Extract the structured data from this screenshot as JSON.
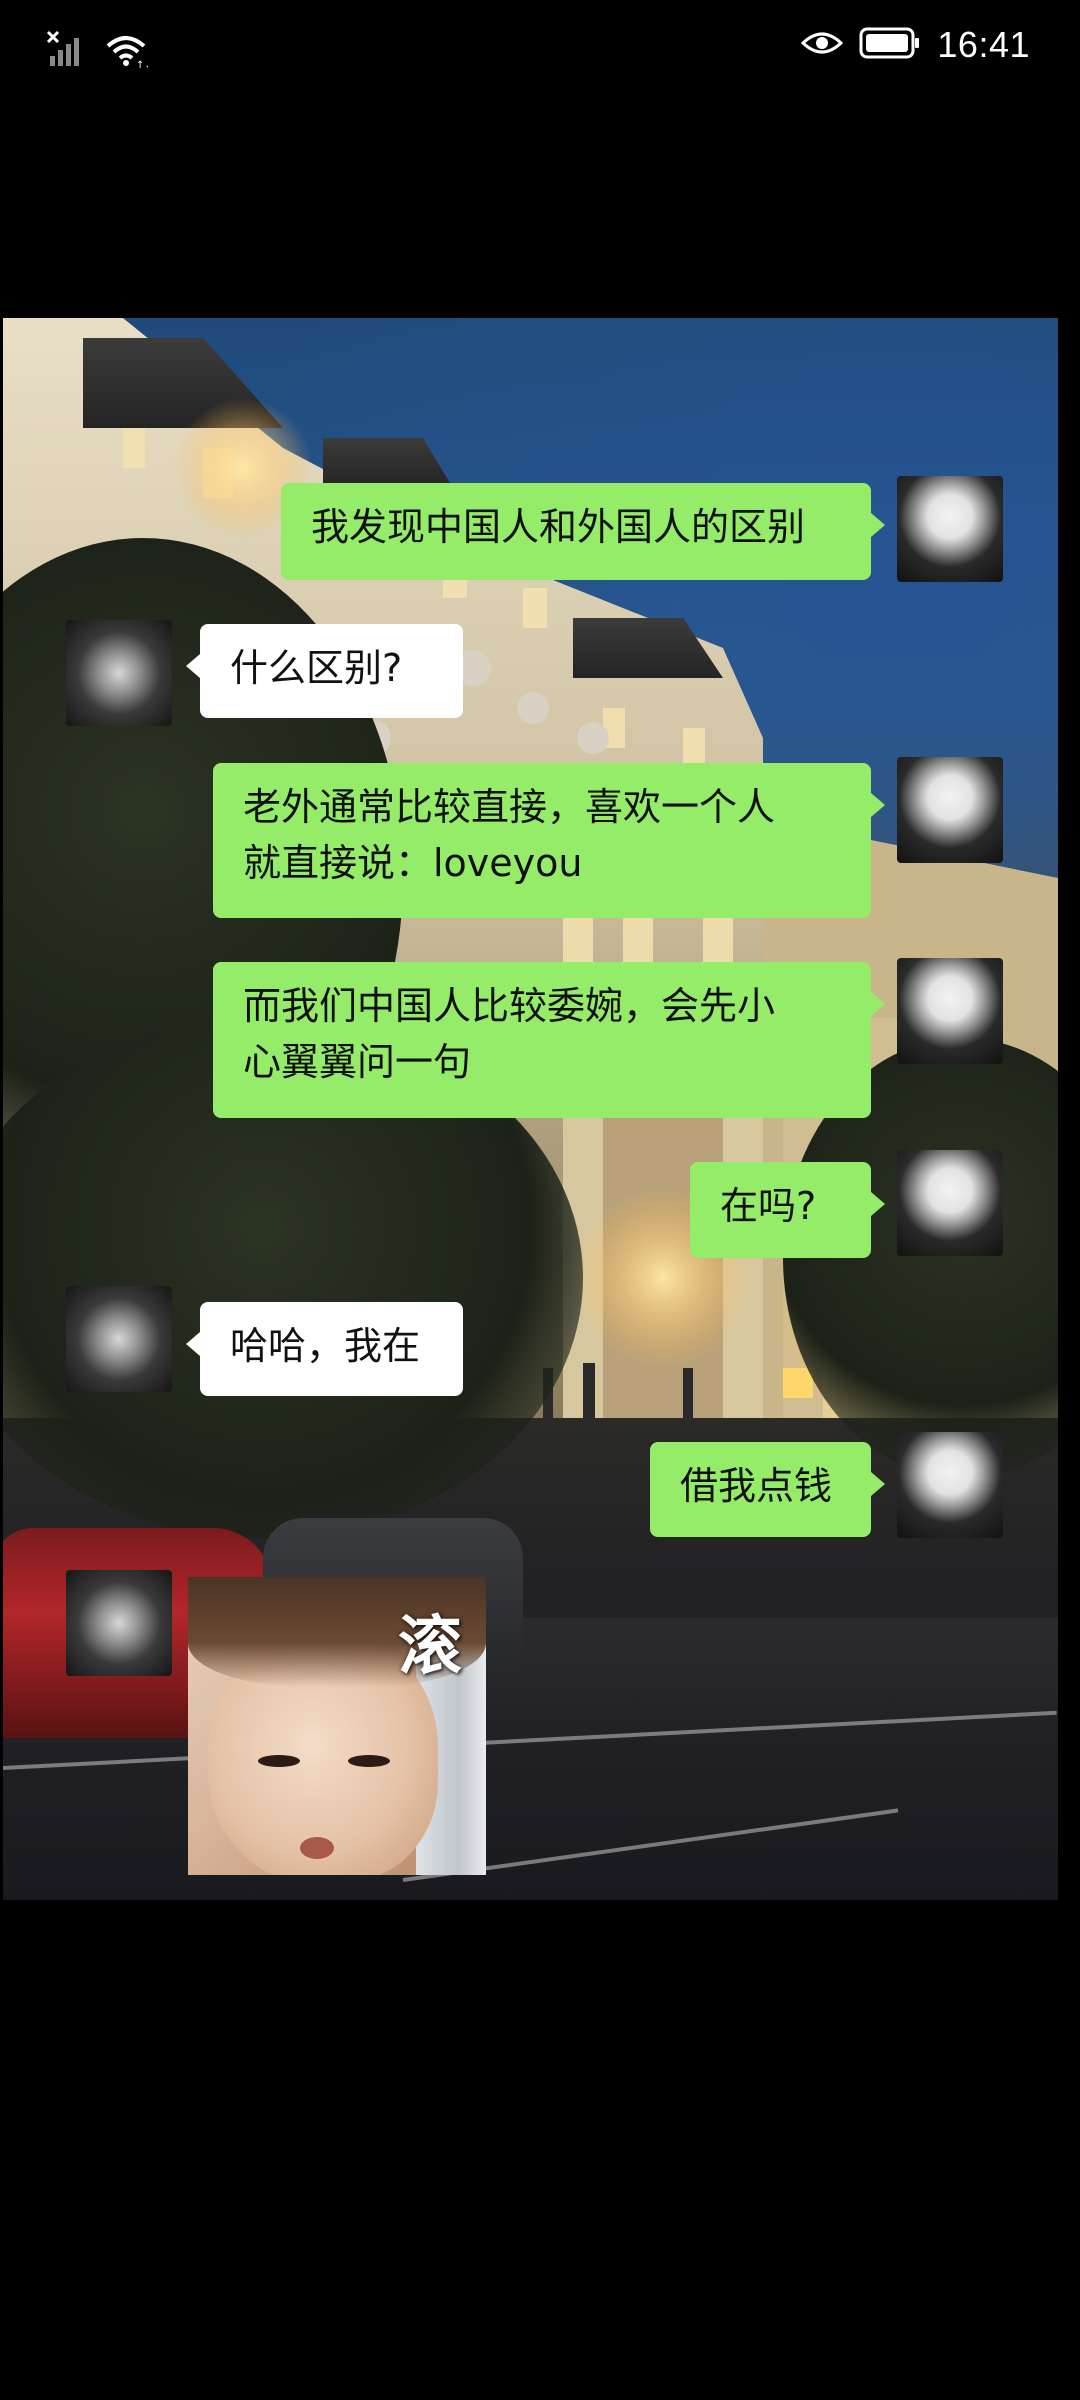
{
  "status_bar": {
    "time": "16:41",
    "icons": [
      "signal-off-icon",
      "wifi-icon",
      "eye-icon",
      "battery-icon"
    ]
  },
  "messages": [
    {
      "sender": "me",
      "text": "我发现中国人和外国人的区别"
    },
    {
      "sender": "them",
      "text": "什么区别?"
    },
    {
      "sender": "me",
      "lines": [
        "老外通常比较直接，喜欢一个人",
        "就直接说：loveyou"
      ]
    },
    {
      "sender": "me",
      "lines": [
        "而我们中国人比较委婉，会先小",
        "心翼翼问一句"
      ]
    },
    {
      "sender": "me",
      "text": "在吗?"
    },
    {
      "sender": "them",
      "text": "哈哈，我在"
    },
    {
      "sender": "me",
      "text": "借我点钱"
    },
    {
      "sender": "them",
      "sticker_text": "滚"
    }
  ],
  "colors": {
    "me_bubble": "#95ec69",
    "them_bubble": "#ffffff",
    "background": "#000000"
  }
}
